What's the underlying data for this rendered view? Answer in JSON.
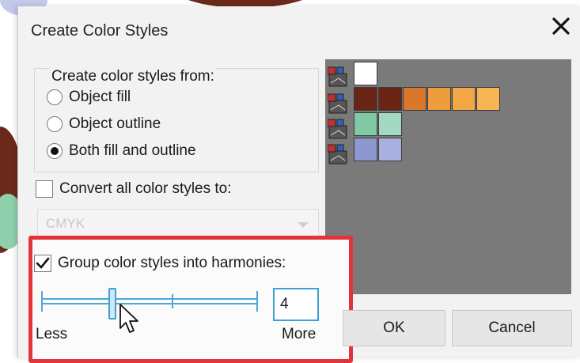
{
  "dialog": {
    "title": "Create Color Styles",
    "close_icon": "close-icon"
  },
  "source": {
    "legend": "Create color styles from:",
    "options": [
      "Object fill",
      "Object outline",
      "Both fill and outline"
    ],
    "selected": "Both fill and outline"
  },
  "convert": {
    "label": "Convert all color styles to:",
    "checked": false,
    "dropdown_value": "CMYK",
    "enabled": false
  },
  "harmonies": {
    "label": "Group color styles into harmonies:",
    "checked": true,
    "slider_value": 4,
    "value_text": "4",
    "min_label": "Less",
    "max_label": "More"
  },
  "preview": {
    "background": "#7a7a7a",
    "rows": [
      [
        "#ffffff"
      ],
      [
        "#6a2413",
        "#6a2413",
        "#d9772a",
        "#ee9c3d",
        "#f2a745",
        "#f6b455"
      ],
      [
        "#7fc9a5",
        "#a3d9c0"
      ],
      [
        "#8e98d0",
        "#a9b0e0"
      ]
    ]
  },
  "buttons": {
    "ok": "OK",
    "cancel": "Cancel"
  },
  "colors": {
    "accent": "#3fa0d4",
    "highlight": "#e3343b"
  }
}
